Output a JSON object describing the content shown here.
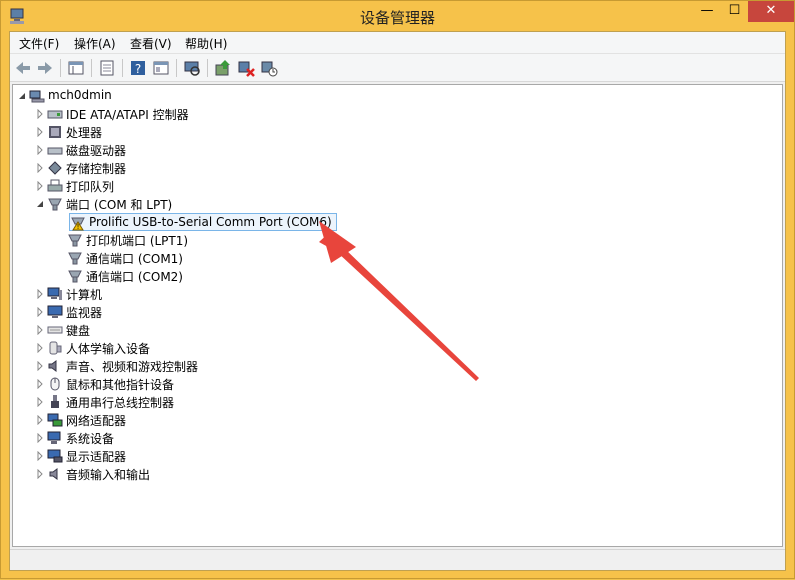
{
  "window": {
    "title": "设备管理器",
    "close_symbol": "✕",
    "min_symbol": "—",
    "max_symbol": "☐"
  },
  "menu": [
    "文件(F)",
    "操作(A)",
    "查看(V)",
    "帮助(H)"
  ],
  "toolbar": [
    "back-icon",
    "forward-icon",
    "properties-grid-icon",
    "document-icon",
    "help-icon",
    "view-icon",
    "scan-icon",
    "update-driver-icon",
    "disable-icon",
    "uninstall-icon"
  ],
  "tree": {
    "root": "mch0dmin",
    "items": [
      {
        "label": "IDE ATA/ATAPI 控制器",
        "icon": "ide-controller-icon"
      },
      {
        "label": "处理器",
        "icon": "processor-icon"
      },
      {
        "label": "磁盘驱动器",
        "icon": "disk-drive-icon"
      },
      {
        "label": "存储控制器",
        "icon": "storage-controller-icon"
      },
      {
        "label": "打印队列",
        "icon": "printer-icon"
      },
      {
        "label": "端口 (COM 和 LPT)",
        "icon": "port-icon",
        "expanded": true,
        "children": [
          {
            "label": "Prolific USB-to-Serial Comm Port (COM6)",
            "icon": "warning-port-icon",
            "selected": true
          },
          {
            "label": "打印机端口 (LPT1)",
            "icon": "port-icon"
          },
          {
            "label": "通信端口 (COM1)",
            "icon": "port-icon"
          },
          {
            "label": "通信端口 (COM2)",
            "icon": "port-icon"
          }
        ]
      },
      {
        "label": "计算机",
        "icon": "computer-icon"
      },
      {
        "label": "监视器",
        "icon": "monitor-icon"
      },
      {
        "label": "键盘",
        "icon": "keyboard-icon"
      },
      {
        "label": "人体学输入设备",
        "icon": "hid-icon"
      },
      {
        "label": "声音、视频和游戏控制器",
        "icon": "sound-icon"
      },
      {
        "label": "鼠标和其他指针设备",
        "icon": "mouse-icon"
      },
      {
        "label": "通用串行总线控制器",
        "icon": "usb-icon"
      },
      {
        "label": "网络适配器",
        "icon": "network-adapter-icon"
      },
      {
        "label": "系统设备",
        "icon": "system-device-icon"
      },
      {
        "label": "显示适配器",
        "icon": "display-adapter-icon"
      },
      {
        "label": "音频输入和输出",
        "icon": "audio-io-icon"
      }
    ]
  },
  "colors": {
    "frame": "#f6c24a",
    "close_button": "#c7463d",
    "arrow": "#e8453c",
    "selection_border": "#7ab5e8"
  }
}
